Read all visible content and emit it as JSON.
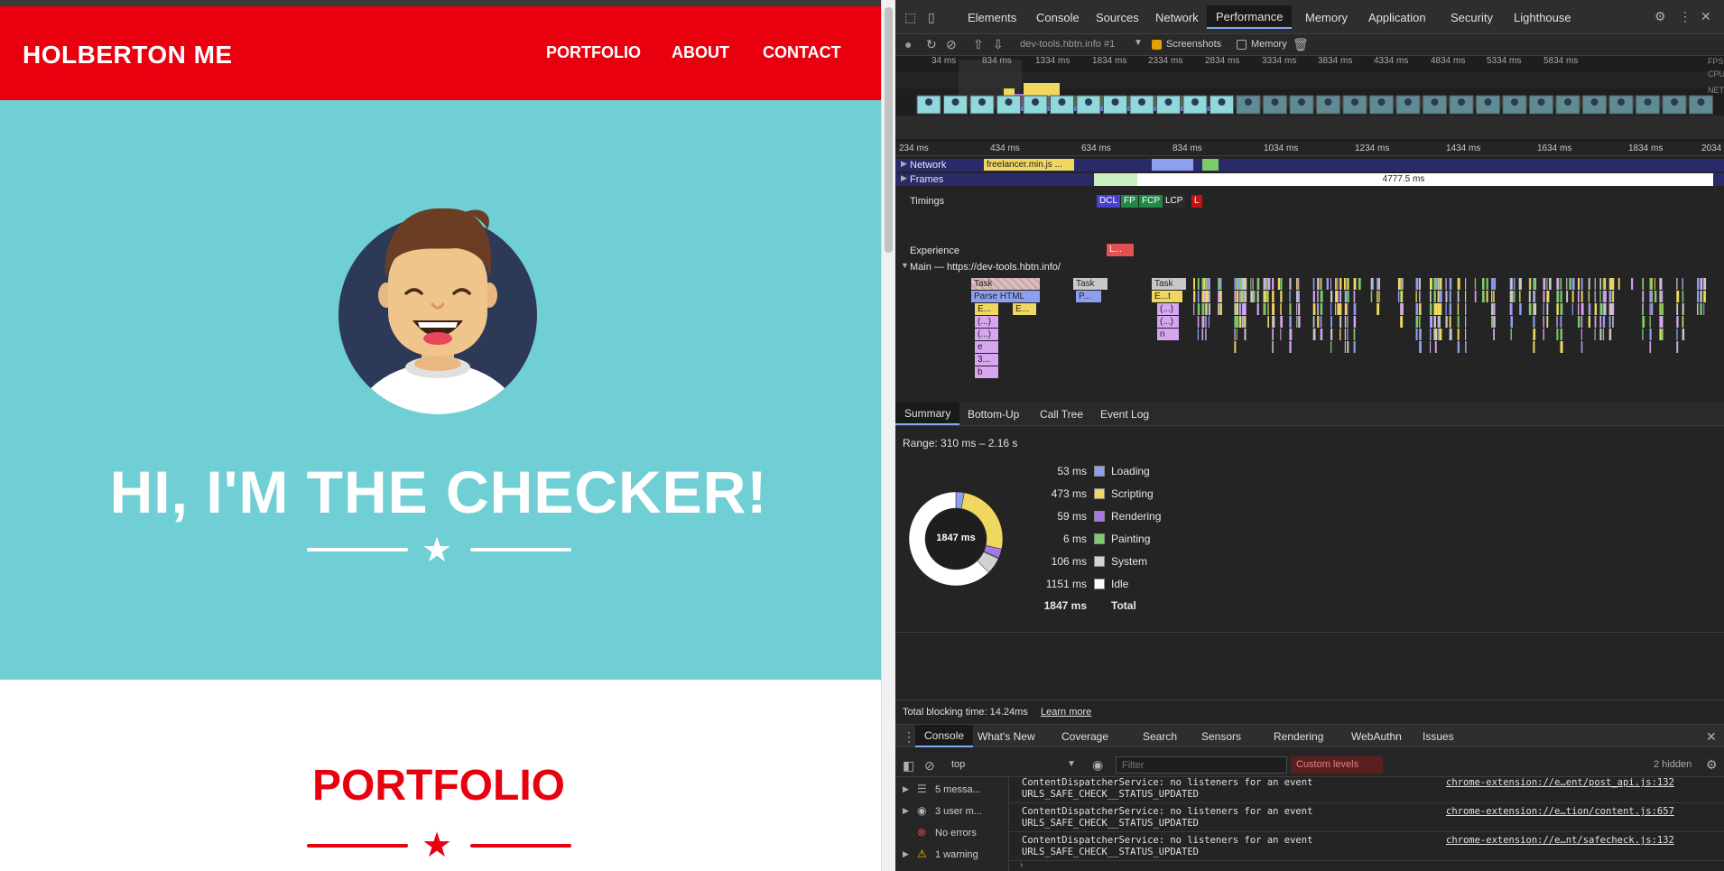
{
  "page": {
    "brand": "HOLBERTON ME",
    "nav": [
      "PORTFOLIO",
      "ABOUT",
      "CONTACT"
    ],
    "hero_title": "HI, I'M THE CHECKER!",
    "section_title": "PORTFOLIO",
    "star_glyph": "★"
  },
  "devtools": {
    "tabs": [
      "Elements",
      "Console",
      "Sources",
      "Network",
      "Performance",
      "Memory",
      "Application",
      "Security",
      "Lighthouse"
    ],
    "active_tab": "Performance",
    "recording_name": "dev-tools.hbtn.info #1",
    "screenshots_label": "Screenshots",
    "memory_label": "Memory",
    "overview_ticks": [
      "34 ms",
      "834 ms",
      "1334 ms",
      "1834 ms",
      "2334 ms",
      "2834 ms",
      "3334 ms",
      "3834 ms",
      "4334 ms",
      "4834 ms",
      "5334 ms",
      "5834 ms"
    ],
    "overview_labels": [
      "FPS",
      "CPU",
      "NET"
    ],
    "timeline_ticks": [
      "234 ms",
      "434 ms",
      "634 ms",
      "834 ms",
      "1034 ms",
      "1234 ms",
      "1434 ms",
      "1634 ms",
      "1834 ms",
      "2034"
    ],
    "tracks": {
      "network": "Network",
      "network_item": "freelancer.min.js ...",
      "frames": "Frames",
      "frame_duration": "4777.5 ms",
      "timings": "Timings",
      "timing_chips": [
        "DCL",
        "FP",
        "FCP",
        "LCP",
        "L"
      ],
      "experience": "Experience",
      "experience_chip": "L...",
      "main": "Main — https://dev-tools.hbtn.info/"
    },
    "flame": {
      "task": "Task",
      "parse_html": "Parse HTML",
      "p": "P...",
      "et": "E...t",
      "e1": "E...",
      "e2": "E...",
      "anon1": "(...)",
      "anon2": "(...)",
      "anon3": "(...)",
      "anon4": "(...)",
      "anon5": "(...)",
      "e_small": "e",
      "three": "3...",
      "b": "b",
      "n": "n"
    },
    "bottom_tabs": [
      "Summary",
      "Bottom-Up",
      "Call Tree",
      "Event Log"
    ],
    "range": "Range: 310 ms – 2.16 s",
    "donut_center": "1847 ms",
    "summary": [
      {
        "value": "53 ms",
        "label": "Loading",
        "color": "#8f9ff0"
      },
      {
        "value": "473 ms",
        "label": "Scripting",
        "color": "#f0d860"
      },
      {
        "value": "59 ms",
        "label": "Rendering",
        "color": "#a875e6"
      },
      {
        "value": "6 ms",
        "label": "Painting",
        "color": "#7dca6a"
      },
      {
        "value": "106 ms",
        "label": "System",
        "color": "#d2d2d2"
      },
      {
        "value": "1151 ms",
        "label": "Idle",
        "color": "#ffffff"
      }
    ],
    "total": {
      "value": "1847 ms",
      "label": "Total"
    },
    "blocking": "Total blocking time: 14.24ms",
    "learn_more": "Learn more",
    "drawer_tabs": [
      "Console",
      "What's New",
      "Coverage",
      "Search",
      "Sensors",
      "Rendering",
      "WebAuthn",
      "Issues"
    ],
    "console_context": "top",
    "filter_placeholder": "Filter",
    "custom_levels": "Custom levels",
    "hidden_count": "2 hidden",
    "sidebar": [
      "5 messa...",
      "3 user m...",
      "No errors",
      "1 warning"
    ],
    "console_rows": [
      {
        "l1": "ContentDispatcherService: no listeners for an event",
        "l2": "URLS_SAFE_CHECK__STATUS_UPDATED",
        "link": "chrome-extension://e…ent/post_api.js:132"
      },
      {
        "l1": "ContentDispatcherService: no listeners for an event",
        "l2": "URLS_SAFE_CHECK__STATUS_UPDATED",
        "link": "chrome-extension://e…tion/content.js:657"
      },
      {
        "l1": "ContentDispatcherService: no listeners for an event",
        "l2": "URLS_SAFE_CHECK__STATUS_UPDATED",
        "link": "chrome-extension://e…nt/safecheck.js:132"
      }
    ]
  }
}
